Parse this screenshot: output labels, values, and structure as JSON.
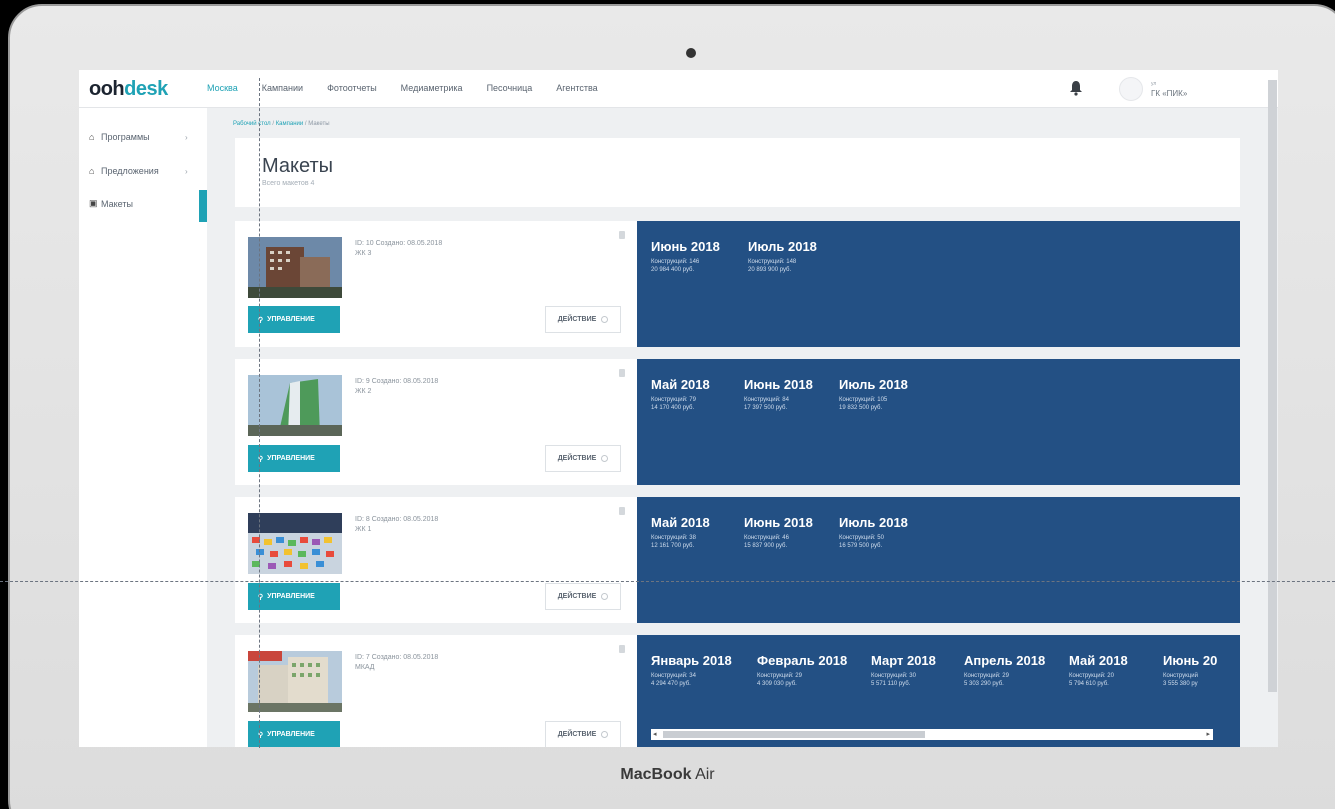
{
  "device": {
    "brand_bold": "MacBook",
    "brand_rest": " Air"
  },
  "header": {
    "logo_a": "ooh",
    "logo_b": "desk",
    "nav": [
      {
        "label": "Москва",
        "active": true
      },
      {
        "label": "Кампании",
        "active": false
      },
      {
        "label": "Фотоотчеты",
        "active": false
      },
      {
        "label": "Медиаметрика",
        "active": false
      },
      {
        "label": "Песочница",
        "active": false
      },
      {
        "label": "Агентства",
        "active": false
      }
    ],
    "user_small": "ул",
    "user_name": "ГК «ПИК»",
    "bell_icon": "bell-icon"
  },
  "sidebar": {
    "items": [
      {
        "label": "Программы",
        "icon": "home-icon",
        "chevron": "›"
      },
      {
        "label": "Предложения",
        "icon": "home-icon",
        "chevron": "›"
      },
      {
        "label": "Макеты",
        "icon": "image-icon",
        "chevron": ""
      }
    ]
  },
  "breadcrumb": {
    "home": "Рабочий стол",
    "sep": "/",
    "mid": "Кампании",
    "current": "Макеты"
  },
  "page": {
    "title": "Макеты",
    "subtitle": "Всего макетов 4"
  },
  "buttons": {
    "manage": "УПРАВЛЕНИЕ",
    "action": "ДЕЙСТВИЕ"
  },
  "mockups": [
    {
      "meta": "ID: 10 Создано: 08.05.2018",
      "name": "ЖК 3",
      "months": [
        {
          "month": "Июнь 2018",
          "constructions": "Конструкций: 146",
          "sum": "20 984 400 руб."
        },
        {
          "month": "Июль 2018",
          "constructions": "Конструкций: 148",
          "sum": "20 893 900 руб."
        }
      ]
    },
    {
      "meta": "ID: 9 Создано: 08.05.2018",
      "name": "ЖК 2",
      "months": [
        {
          "month": "Май 2018",
          "constructions": "Конструкций: 79",
          "sum": "14 170 400 руб."
        },
        {
          "month": "Июнь 2018",
          "constructions": "Конструкций: 84",
          "sum": "17 397 500 руб."
        },
        {
          "month": "Июль 2018",
          "constructions": "Конструкций: 105",
          "sum": "19 832 500 руб."
        }
      ]
    },
    {
      "meta": "ID: 8 Создано: 08.05.2018",
      "name": "ЖК 1",
      "months": [
        {
          "month": "Май 2018",
          "constructions": "Конструкций: 38",
          "sum": "12 161 700 руб."
        },
        {
          "month": "Июнь 2018",
          "constructions": "Конструкций: 46",
          "sum": "15 837 900 руб."
        },
        {
          "month": "Июль 2018",
          "constructions": "Конструкций: 50",
          "sum": "16 579 500 руб."
        }
      ]
    },
    {
      "meta": "ID: 7 Создано: 08.05.2018",
      "name": "МКАД",
      "months": [
        {
          "month": "Январь 2018",
          "constructions": "Конструкций: 34",
          "sum": "4 294 470 руб."
        },
        {
          "month": "Февраль 2018",
          "constructions": "Конструкций: 29",
          "sum": "4 309 030 руб."
        },
        {
          "month": "Март 2018",
          "constructions": "Конструкций: 30",
          "sum": "5 571 110 руб."
        },
        {
          "month": "Апрель 2018",
          "constructions": "Конструкций: 29",
          "sum": "5 303 290 руб."
        },
        {
          "month": "Май 2018",
          "constructions": "Конструкций: 20",
          "sum": "5 794 610 руб."
        },
        {
          "month": "Июнь 20",
          "constructions": "Конструкций",
          "sum": "3 555 380 ру"
        }
      ]
    }
  ],
  "colors": {
    "accent": "#1fa2b5",
    "panel": "#235084"
  }
}
